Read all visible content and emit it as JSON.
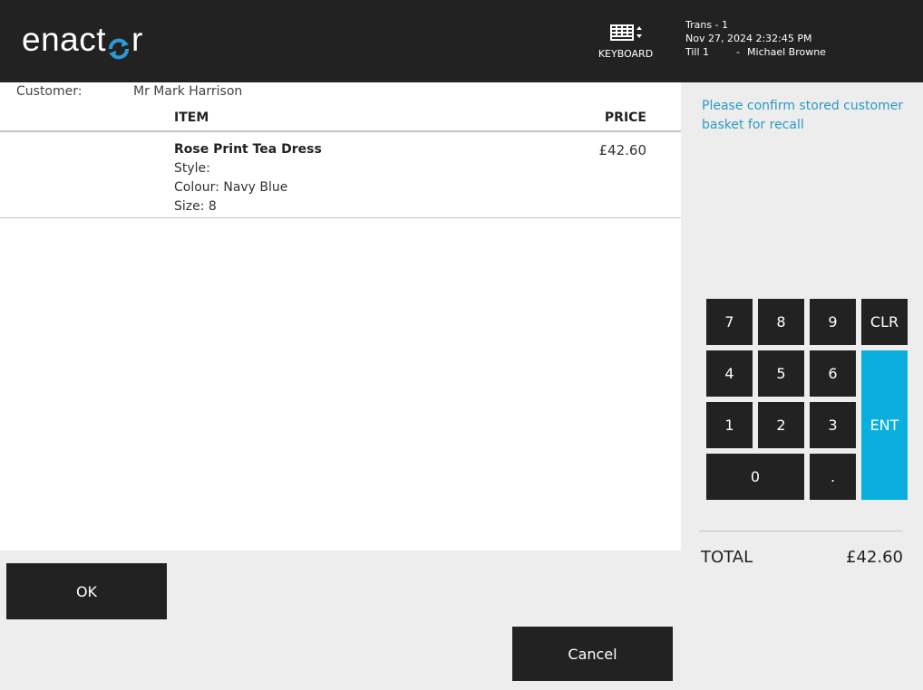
{
  "header": {
    "logo_text_before": "enact",
    "logo_text_after": "r",
    "logo_accent_color": "#2a9bd6",
    "keyboard_icon": "keyboard-icon",
    "keyboard_label": "KEYBOARD",
    "trans": "Trans - 1",
    "datetime": "Nov 27, 2024 2:32:45 PM",
    "till": "Till 1",
    "separator": "-",
    "operator": "Michael Browne"
  },
  "basket": {
    "customer_label": "Customer:",
    "customer_name": "Mr Mark Harrison",
    "columns": {
      "item": "ITEM",
      "price": "PRICE"
    },
    "items": [
      {
        "name": "Rose Print Tea Dress",
        "style": "Style:",
        "colour": "Colour: Navy Blue",
        "size": "Size: 8",
        "price": "£42.60"
      }
    ]
  },
  "prompt": "Please confirm stored customer basket for recall",
  "keypad": {
    "keys": [
      "7",
      "8",
      "9",
      "CLR",
      "4",
      "5",
      "6",
      "1",
      "2",
      "3",
      "0",
      ".",
      "ENT"
    ],
    "enter_color": "#0aafe0"
  },
  "totals": {
    "label": "TOTAL",
    "value": "£42.60"
  },
  "actions": {
    "ok": "OK",
    "cancel": "Cancel"
  }
}
